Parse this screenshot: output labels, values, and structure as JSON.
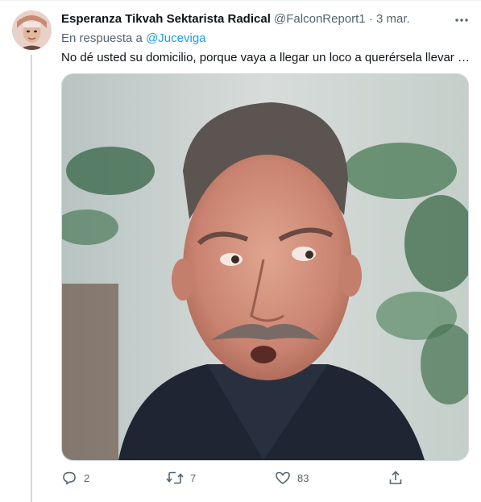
{
  "tweet": {
    "author_name": "Esperanza Tikvah Sektarista Radical",
    "handle": "@FalconReport1",
    "separator": "·",
    "date": "3 mar.",
    "reply_prefix": "En respuesta a",
    "reply_handle": "@Juceviga",
    "text": "No dé usted su domicilio, porque vaya a llegar un loco a querérsela llevar …"
  },
  "actions": {
    "replies": "2",
    "retweets": "7",
    "likes": "83"
  },
  "icons": [
    "more-icon",
    "reply-icon",
    "retweet-icon",
    "like-icon",
    "share-icon"
  ],
  "colors": {
    "link": "#1d9bf0",
    "secondary_text": "#536471",
    "thread_line": "#cfd9de"
  }
}
